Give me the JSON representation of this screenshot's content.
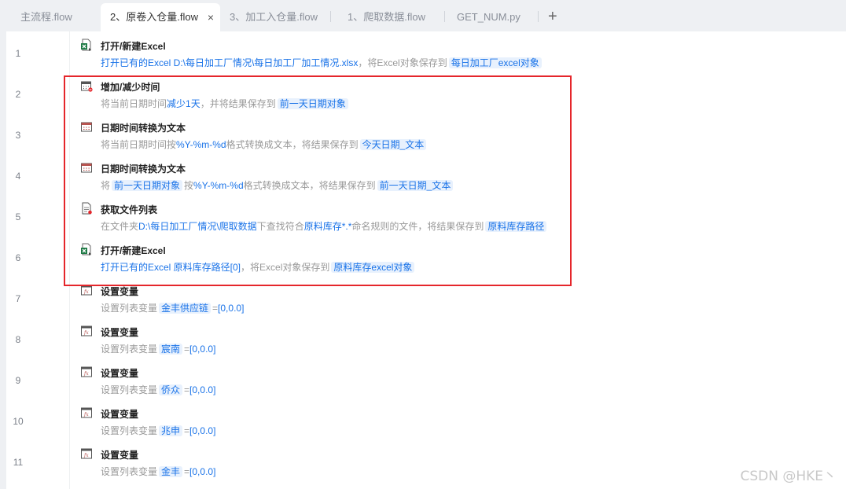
{
  "tabs": [
    {
      "label": "主流程.flow",
      "active": false
    },
    {
      "label": "2、原卷入仓量.flow",
      "active": true
    },
    {
      "label": "3、加工入仓量.flow",
      "active": false
    },
    {
      "label": "1、爬取数据.flow",
      "active": false
    },
    {
      "label": "GET_NUM.py",
      "active": false
    }
  ],
  "tab_close": "×",
  "tab_add": "+",
  "steps": [
    {
      "line": "1",
      "icon": "excel-icon",
      "title": "打开/新建Excel",
      "desc": [
        {
          "t": "hl",
          "v": "打开已有的Excel D:\\每日加工厂情况\\每日加工厂加工情况.xlsx"
        },
        {
          "t": "text",
          "v": "，将Excel对象保存到"
        },
        {
          "t": "tag",
          "v": "每日加工厂excel对象"
        }
      ]
    },
    {
      "line": "2",
      "icon": "calendar-minus-icon",
      "title": "增加/减少时间",
      "desc": [
        {
          "t": "text",
          "v": "将当前日期时间"
        },
        {
          "t": "hl",
          "v": "减少1天"
        },
        {
          "t": "text",
          "v": "，并将结果保存到"
        },
        {
          "t": "tag",
          "v": "前一天日期对象"
        }
      ]
    },
    {
      "line": "3",
      "icon": "calendar-icon",
      "title": "日期时间转换为文本",
      "desc": [
        {
          "t": "text",
          "v": "将当前日期时间按"
        },
        {
          "t": "hl",
          "v": "%Y-%m-%d"
        },
        {
          "t": "text",
          "v": "格式转换成文本，将结果保存到"
        },
        {
          "t": "tag",
          "v": "今天日期_文本"
        }
      ]
    },
    {
      "line": "4",
      "icon": "calendar-icon",
      "title": "日期时间转换为文本",
      "desc": [
        {
          "t": "text",
          "v": "将"
        },
        {
          "t": "tag",
          "v": "前一天日期对象"
        },
        {
          "t": "text",
          "v": "按"
        },
        {
          "t": "hl",
          "v": "%Y-%m-%d"
        },
        {
          "t": "text",
          "v": "格式转换成文本，将结果保存到"
        },
        {
          "t": "tag",
          "v": "前一天日期_文本"
        }
      ]
    },
    {
      "line": "5",
      "icon": "file-list-icon",
      "title": "获取文件列表",
      "desc": [
        {
          "t": "text",
          "v": "在文件夹"
        },
        {
          "t": "hl",
          "v": "D:\\每日加工厂情况\\爬取数据"
        },
        {
          "t": "text",
          "v": "下查找符合"
        },
        {
          "t": "hl",
          "v": "原料库存*.*"
        },
        {
          "t": "text",
          "v": "命名规则的文件，将结果保存到"
        },
        {
          "t": "tag",
          "v": "原料库存路径"
        }
      ]
    },
    {
      "line": "6",
      "icon": "excel-icon",
      "title": "打开/新建Excel",
      "desc": [
        {
          "t": "hl",
          "v": "打开已有的Excel 原料库存路径[0]"
        },
        {
          "t": "text",
          "v": "，将Excel对象保存到"
        },
        {
          "t": "tag",
          "v": "原料库存excel对象"
        }
      ]
    },
    {
      "line": "7",
      "icon": "variable-icon",
      "title": "设置变量",
      "desc": [
        {
          "t": "text",
          "v": "设置列表变量"
        },
        {
          "t": "tag",
          "v": "金丰供应链"
        },
        {
          "t": "text",
          "v": "="
        },
        {
          "t": "hl",
          "v": "[0,0.0]"
        }
      ]
    },
    {
      "line": "8",
      "icon": "variable-icon",
      "title": "设置变量",
      "desc": [
        {
          "t": "text",
          "v": "设置列表变量"
        },
        {
          "t": "tag",
          "v": "宸南"
        },
        {
          "t": "text",
          "v": "="
        },
        {
          "t": "hl",
          "v": "[0,0.0]"
        }
      ]
    },
    {
      "line": "9",
      "icon": "variable-icon",
      "title": "设置变量",
      "desc": [
        {
          "t": "text",
          "v": "设置列表变量"
        },
        {
          "t": "tag",
          "v": "侨众"
        },
        {
          "t": "text",
          "v": "="
        },
        {
          "t": "hl",
          "v": "[0,0.0]"
        }
      ]
    },
    {
      "line": "10",
      "icon": "variable-icon",
      "title": "设置变量",
      "desc": [
        {
          "t": "text",
          "v": "设置列表变量"
        },
        {
          "t": "tag",
          "v": "兆申"
        },
        {
          "t": "text",
          "v": "="
        },
        {
          "t": "hl",
          "v": "[0,0.0]"
        }
      ]
    },
    {
      "line": "11",
      "icon": "variable-icon",
      "title": "设置变量",
      "desc": [
        {
          "t": "text",
          "v": "设置列表变量"
        },
        {
          "t": "tag",
          "v": "金丰"
        },
        {
          "t": "text",
          "v": "="
        },
        {
          "t": "hl",
          "v": "[0,0.0]"
        }
      ]
    }
  ],
  "watermark": "CSDN @HKE丶",
  "colors": {
    "accent": "#1a73e8",
    "highlight_box": "#e5262b",
    "excel": "#1e7a45"
  }
}
